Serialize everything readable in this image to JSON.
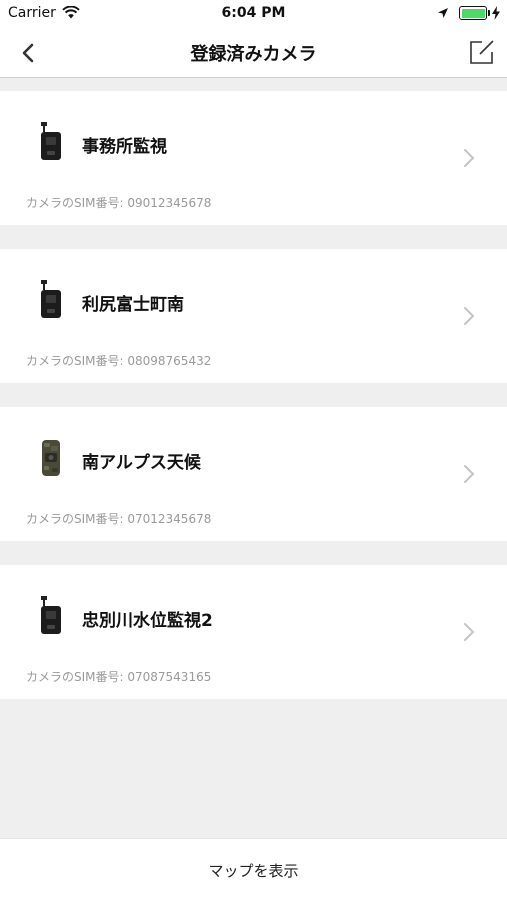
{
  "status_bar": {
    "carrier": "Carrier",
    "time": "6:04 PM",
    "battery_color": "#4cd964"
  },
  "nav": {
    "title": "登録済みカメラ",
    "back_icon": "chevron-left-icon",
    "edit_icon": "compose-icon"
  },
  "cameras": [
    {
      "name": "事務所監視",
      "sim": "カメラのSIM番号: 09012345678",
      "icon": "camera-device-black"
    },
    {
      "name": "利尻富士町南",
      "sim": "カメラのSIM番号: 08098765432",
      "icon": "camera-device-black"
    },
    {
      "name": "南アルプス天候",
      "sim": "カメラのSIM番号: 07012345678",
      "icon": "camera-device-camo"
    },
    {
      "name": "忠別川水位監視2",
      "sim": "カメラのSIM番号: 07087543165",
      "icon": "camera-device-black"
    }
  ],
  "footer": {
    "map_button": "マップを表示"
  }
}
